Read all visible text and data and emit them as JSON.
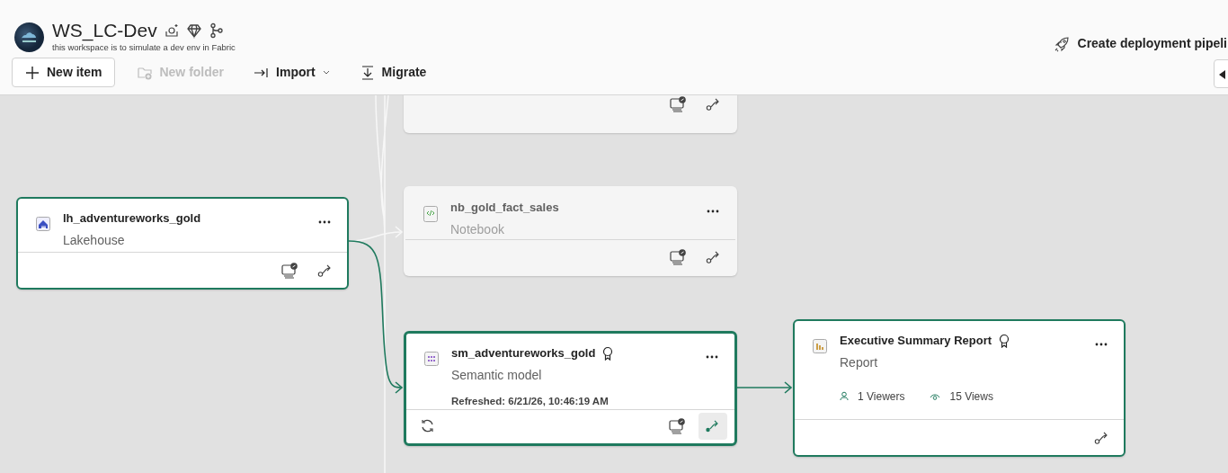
{
  "workspace": {
    "title": "WS_LC-Dev",
    "description": "this workspace is to simulate a dev env in Fabric"
  },
  "toolbar": [
    {
      "kind": "add",
      "label": "New item",
      "disabled": false
    },
    {
      "kind": "folder",
      "label": "New folder",
      "disabled": true
    },
    {
      "kind": "import",
      "label": "Import",
      "disabled": false
    },
    {
      "kind": "migrate",
      "label": "Migrate",
      "disabled": false
    }
  ],
  "header_action": {
    "label": "Create deployment pipeli"
  },
  "nodes": [
    {
      "kind": "partial",
      "dimmed": true,
      "selected": false,
      "refresh": false,
      "monitor": true,
      "lineage": true
    },
    {
      "kind": "lakehouse",
      "dimmed": false,
      "selected": false,
      "name": "lh_adventureworks_gold",
      "type": "Lakehouse",
      "refresh": false,
      "monitor": true,
      "lineage": true
    },
    {
      "kind": "notebook",
      "dimmed": true,
      "selected": false,
      "name": "nb_gold_fact_sales",
      "type": "Notebook",
      "refresh": false,
      "monitor": true,
      "lineage": true
    },
    {
      "kind": "semantic",
      "dimmed": false,
      "selected": true,
      "name": "sm_adventureworks_gold",
      "type": "Semantic model",
      "endorsed": true,
      "refreshed": "Refreshed: 6/21/26, 10:46:19 AM",
      "refresh": true,
      "monitor": true,
      "lineage": true,
      "lineage_active": true
    },
    {
      "kind": "report",
      "dimmed": false,
      "selected": false,
      "name": "Executive Summary Report",
      "type": "Report",
      "endorsed": true,
      "stats": [
        {
          "kind": "viewers",
          "text": "1 Viewers"
        },
        {
          "kind": "views",
          "text": "15 Views"
        }
      ],
      "refresh": false,
      "monitor": false,
      "lineage": true
    }
  ],
  "edges": [
    {
      "highlighted": false
    },
    {
      "highlighted": true
    },
    {
      "highlighted": true
    }
  ]
}
